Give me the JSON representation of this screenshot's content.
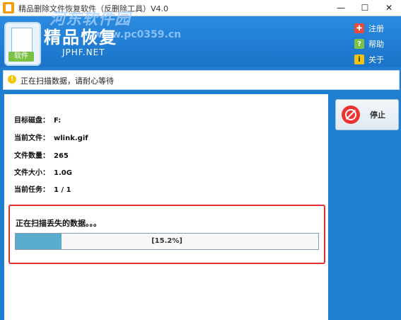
{
  "window": {
    "title": "精品删除文件恢复软件（反删除工具）V4.0",
    "controls": {
      "minimize": "—",
      "maximize": "☐",
      "close": "✕"
    }
  },
  "header": {
    "brand": "精品恢复",
    "brand_sub": "JPHF.NET",
    "logo_tag": "软件",
    "watermark": "河东软件园",
    "watermark_url": "www.pc0359.cn",
    "links": [
      {
        "label": "注册",
        "icon": "register-icon"
      },
      {
        "label": "帮助",
        "icon": "help-icon"
      },
      {
        "label": "关于",
        "icon": "about-icon"
      }
    ]
  },
  "status": {
    "text": "正在扫描数据，请耐心等待"
  },
  "info": {
    "disk_label": "目标磁盘：",
    "disk_value": "F:",
    "file_label": "当前文件：",
    "file_value": "wlink.gif",
    "count_label": "文件数量：",
    "count_value": "265",
    "size_label": "文件大小：",
    "size_value": "1.0G",
    "task_label": "当前任务：",
    "task_value": "1 / 1"
  },
  "scan": {
    "label": "正在扫描丢失的数据。。。",
    "progress_text": "[15.2%]",
    "progress_fraction": 0.152
  },
  "stop": {
    "label": "停止"
  },
  "colors": {
    "accent": "#1e7fd0",
    "progress": "#5aaccf",
    "highlight": "#e03030",
    "stop": "#e33333"
  }
}
